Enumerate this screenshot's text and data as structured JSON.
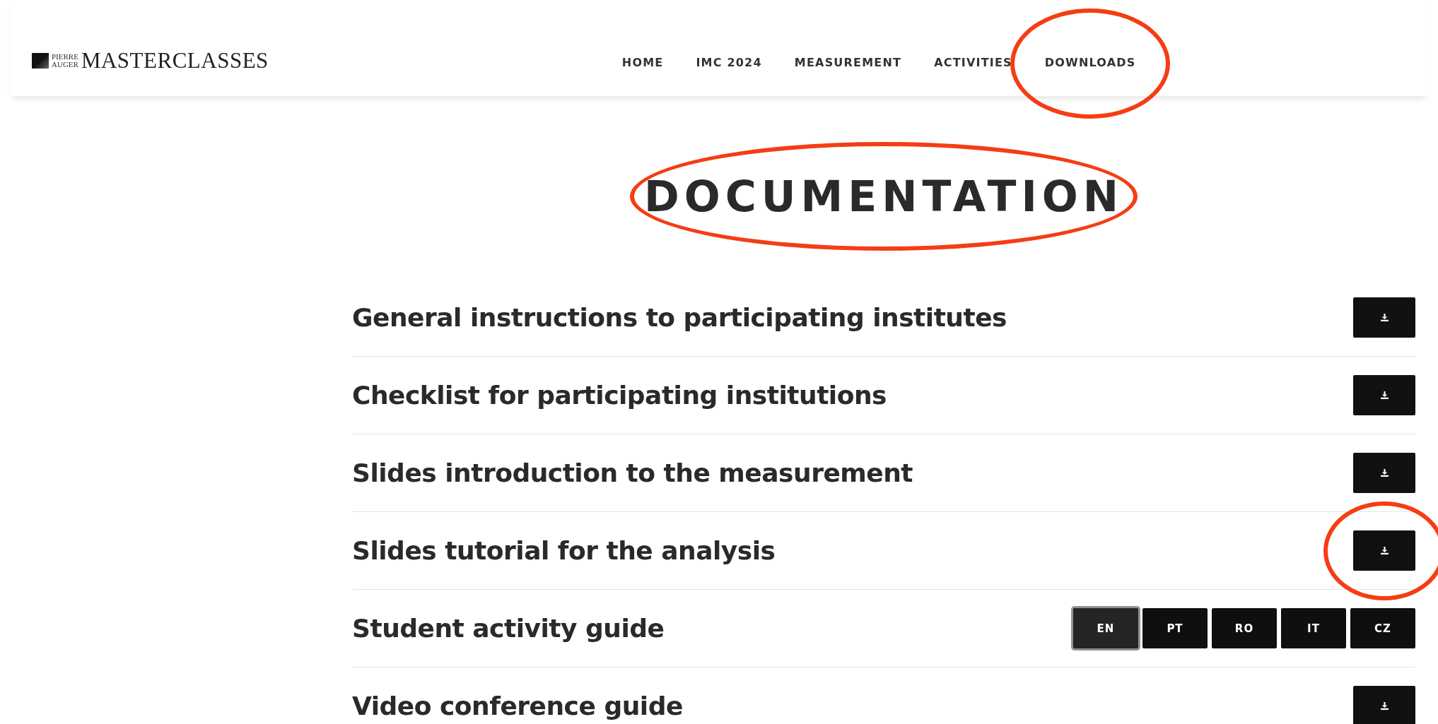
{
  "logo": {
    "small_top": "PIERRE",
    "small_bottom": "AUGER",
    "name": "MASTERCLASSES"
  },
  "nav": [
    {
      "label": "HOME",
      "highlighted": false
    },
    {
      "label": "IMC 2024",
      "highlighted": false
    },
    {
      "label": "MEASUREMENT",
      "highlighted": false
    },
    {
      "label": "ACTIVITIES",
      "highlighted": false
    },
    {
      "label": "DOWNLOADS",
      "highlighted": true
    }
  ],
  "page_title": {
    "text": "DOCUMENTATION",
    "highlighted": true
  },
  "documents": [
    {
      "title": "General instructions to participating institutes",
      "kind": "download",
      "highlighted": false
    },
    {
      "title": "Checklist for participating institutions",
      "kind": "download",
      "highlighted": false
    },
    {
      "title": "Slides introduction to the measurement",
      "kind": "download",
      "highlighted": false
    },
    {
      "title": "Slides tutorial for the analysis",
      "kind": "download",
      "highlighted": true
    },
    {
      "title": "Student activity guide",
      "kind": "languages",
      "languages": [
        {
          "label": "EN",
          "selected": true
        },
        {
          "label": "PT",
          "selected": false
        },
        {
          "label": "RO",
          "selected": false
        },
        {
          "label": "IT",
          "selected": false
        },
        {
          "label": "CZ",
          "selected": false
        }
      ]
    },
    {
      "title": "Video conference guide",
      "kind": "download",
      "highlighted": false
    }
  ]
}
